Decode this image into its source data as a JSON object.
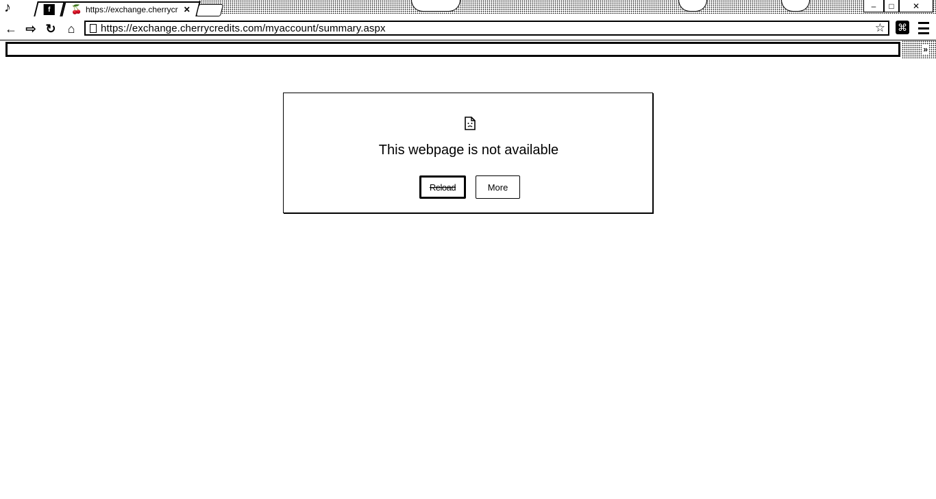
{
  "tabs": [
    {
      "favicon": "facebook-icon",
      "label": "",
      "active": false
    },
    {
      "favicon": "cherry-icon",
      "label": "https://exchange.cherrycr",
      "active": true
    }
  ],
  "window_controls": {
    "minimize": "–",
    "maximize": "□",
    "close": "✕"
  },
  "toolbar": {
    "back": "←",
    "forward": "⇨",
    "reload": "↻",
    "home": "⌂",
    "url": "https://exchange.cherrycredits.com/myaccount/summary.aspx",
    "star": "☆",
    "extension": "⌘"
  },
  "bookmarks": {
    "chevron": "»"
  },
  "error": {
    "icon": "sad-page-icon",
    "title": "This webpage is not available",
    "reload_label": "Reload",
    "more_label": "More"
  }
}
